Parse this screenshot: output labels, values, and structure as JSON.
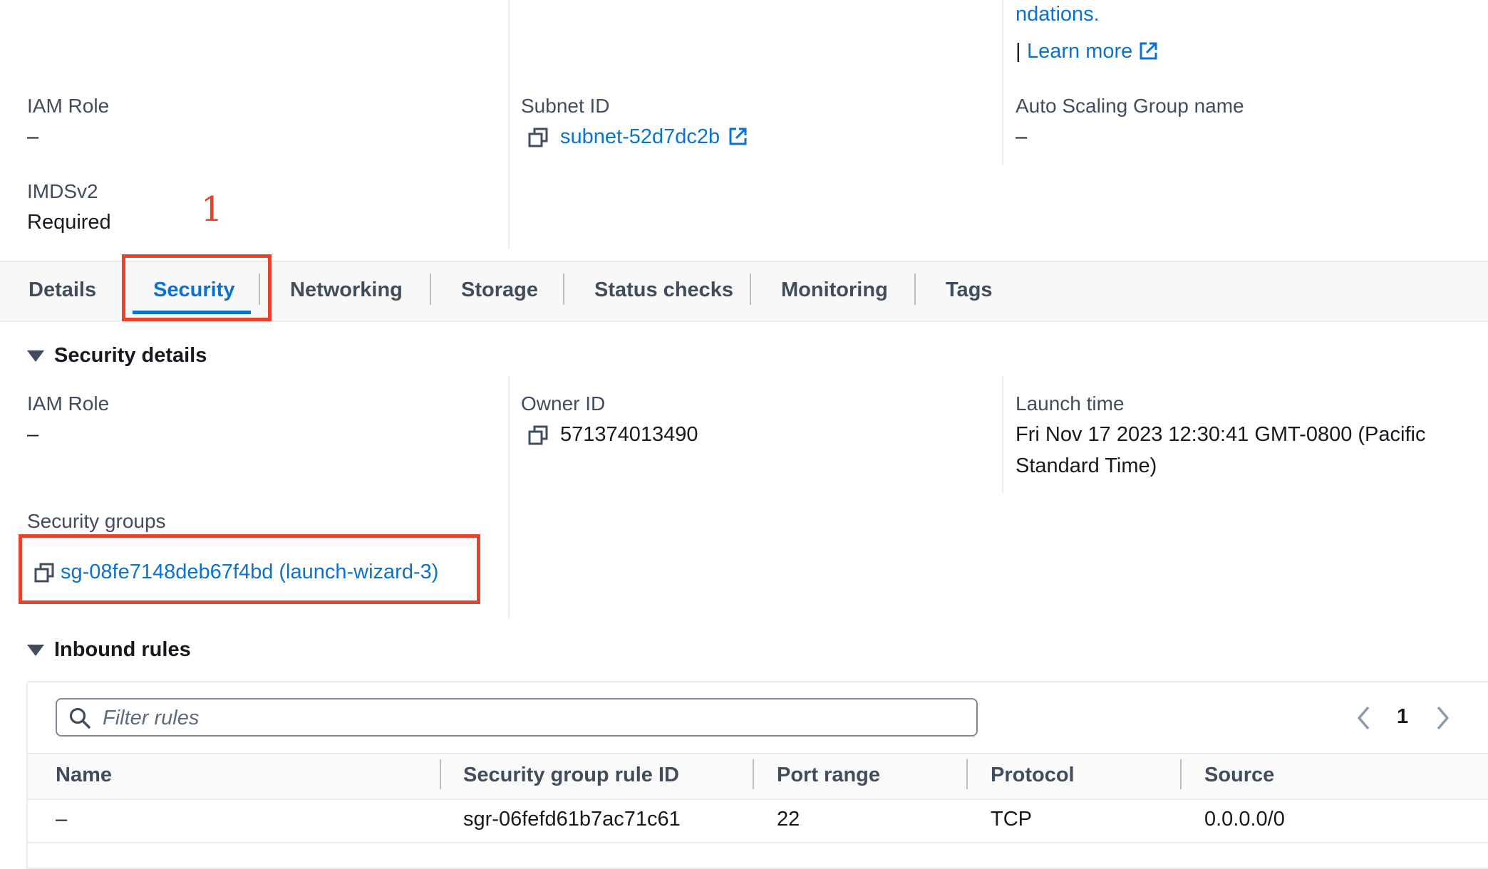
{
  "top_section": {
    "partial_link": "ndations.",
    "pipe": "|",
    "learn_more": "Learn more",
    "iam_role_label": "IAM Role",
    "iam_role_value": "–",
    "subnet_label": "Subnet ID",
    "subnet_value": "subnet-52d7dc2b",
    "asg_label": "Auto Scaling Group name",
    "asg_value": "–",
    "imds_label": "IMDSv2",
    "imds_value": "Required"
  },
  "annotation_number": "1",
  "tabs": [
    {
      "label": "Details",
      "active": false
    },
    {
      "label": "Security",
      "active": true
    },
    {
      "label": "Networking",
      "active": false
    },
    {
      "label": "Storage",
      "active": false
    },
    {
      "label": "Status checks",
      "active": false
    },
    {
      "label": "Monitoring",
      "active": false
    },
    {
      "label": "Tags",
      "active": false
    }
  ],
  "security_details": {
    "title": "Security details",
    "iam_role_label": "IAM Role",
    "iam_role_value": "–",
    "owner_label": "Owner ID",
    "owner_value": "571374013490",
    "launch_label": "Launch time",
    "launch_value_line1": "Fri Nov 17 2023 12:30:41 GMT-0800 (Pacific",
    "launch_value_line2": "Standard Time)",
    "sg_label": "Security groups",
    "sg_value": "sg-08fe7148deb67f4bd (launch-wizard-3)"
  },
  "inbound_rules": {
    "title": "Inbound rules",
    "filter_placeholder": "Filter rules",
    "page": "1",
    "columns": [
      "Name",
      "Security group rule ID",
      "Port range",
      "Protocol",
      "Source"
    ],
    "rows": [
      [
        "–",
        "sgr-06fefd61b7ac71c61",
        "22",
        "TCP",
        "0.0.0.0/0"
      ]
    ]
  },
  "colors": {
    "link": "#0972d3",
    "highlight": "#e8412c",
    "text": "#16191f",
    "label": "#414d5c"
  }
}
